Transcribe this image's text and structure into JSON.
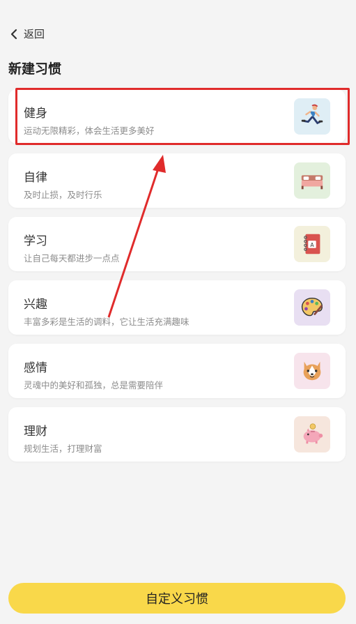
{
  "nav": {
    "back_label": "返回"
  },
  "page_title": "新建习惯",
  "habits": [
    {
      "name": "健身",
      "desc": "运动无限精彩，体会生活更多美好",
      "icon": "running-person-icon",
      "bg": "#dfeef5"
    },
    {
      "name": "自律",
      "desc": "及时止损，及时行乐",
      "icon": "bed-icon",
      "bg": "#e3f0dd"
    },
    {
      "name": "学习",
      "desc": "让自己每天都进步一点点",
      "icon": "notebook-icon",
      "bg": "#f3f0dc"
    },
    {
      "name": "兴趣",
      "desc": "丰富多彩是生活的调料，它让生活充满趣味",
      "icon": "palette-icon",
      "bg": "#e8dff2"
    },
    {
      "name": "感情",
      "desc": "灵魂中的美好和孤独，总是需要陪伴",
      "icon": "dog-icon",
      "bg": "#f7e4ec"
    },
    {
      "name": "理财",
      "desc": "规划生活，打理财富",
      "icon": "piggy-bank-icon",
      "bg": "#f6e6dd"
    }
  ],
  "footer": {
    "custom_label": "自定义习惯"
  },
  "colors": {
    "accent": "#f9d84a",
    "annotation": "#e02b2b"
  }
}
